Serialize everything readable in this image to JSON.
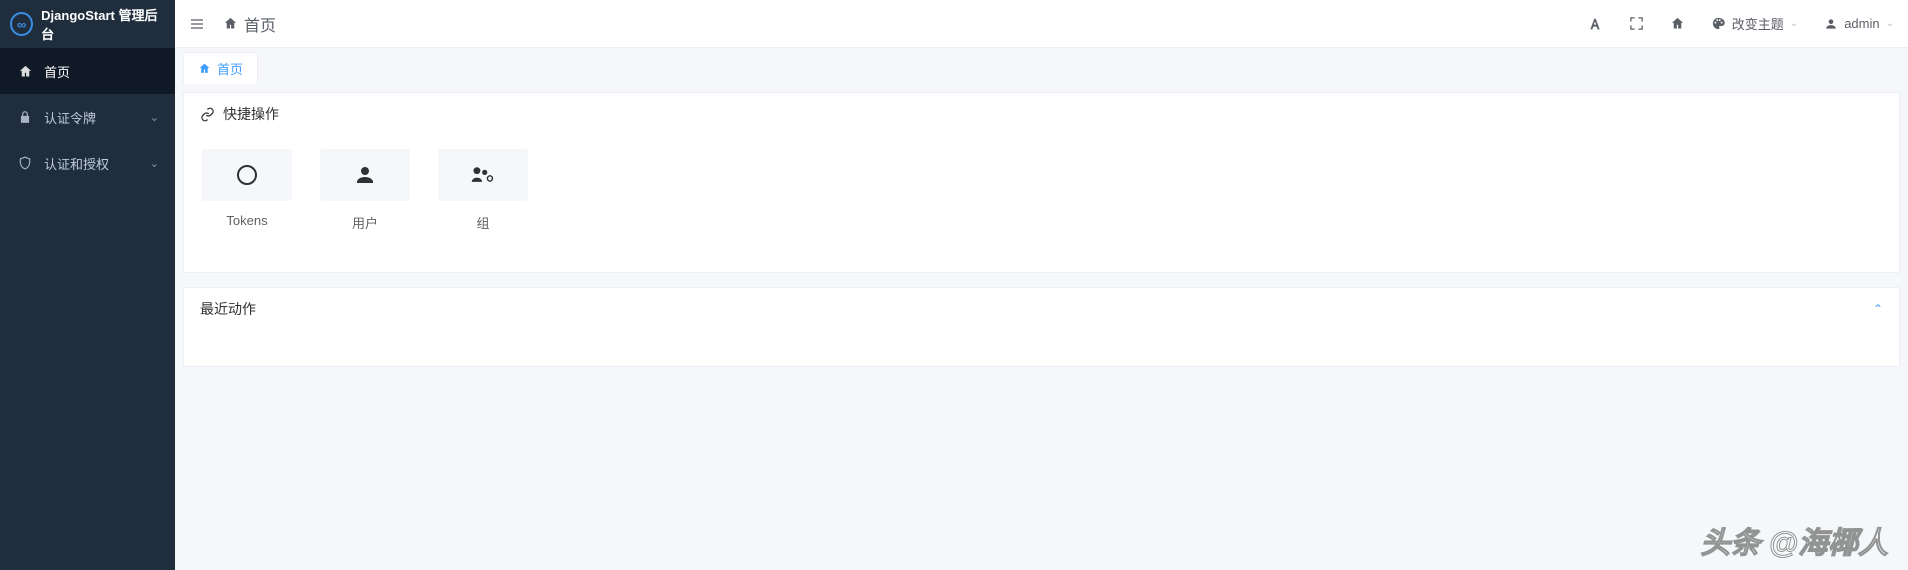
{
  "brand": {
    "title": "DjangoStart 管理后台"
  },
  "sidebar": {
    "items": [
      {
        "label": "首页",
        "icon": "home",
        "active": true
      },
      {
        "label": "认证令牌",
        "icon": "lock",
        "expandable": true
      },
      {
        "label": "认证和授权",
        "icon": "shield",
        "expandable": true
      }
    ]
  },
  "topbar": {
    "home_label": "首页",
    "theme_label": "改变主题",
    "user_label": "admin"
  },
  "tabs": [
    {
      "label": "首页",
      "active": true
    }
  ],
  "quick_actions": {
    "title": "快捷操作",
    "items": [
      {
        "label": "Tokens",
        "icon": "circle"
      },
      {
        "label": "用户",
        "icon": "user"
      },
      {
        "label": "组",
        "icon": "users-cog"
      }
    ]
  },
  "recent_actions": {
    "title": "最近动作"
  },
  "watermark": "头条 @海椰人"
}
